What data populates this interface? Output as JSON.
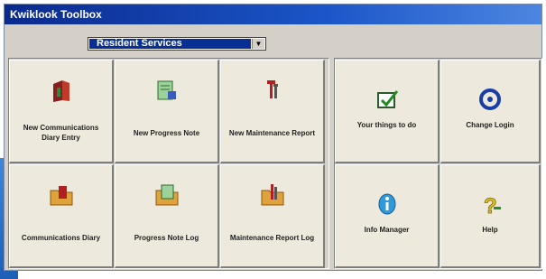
{
  "window": {
    "title": "Kwiklook Toolbox"
  },
  "selector": {
    "value": "Resident Services"
  },
  "buttons": {
    "new_diary": {
      "label": "New Communications Diary Entry",
      "icon": "red-book-icon"
    },
    "new_progress": {
      "label": "New Progress Note",
      "icon": "note-pencil-icon"
    },
    "new_maintenance": {
      "label": "New Maintenance Report",
      "icon": "tools-icon"
    },
    "things_to_do": {
      "label": "Your things to do",
      "icon": "green-checkbox-icon"
    },
    "change_login": {
      "label": "Change Login",
      "icon": "blue-ring-icon"
    },
    "diary": {
      "label": "Communications Diary",
      "icon": "folder-book-icon"
    },
    "progress_log": {
      "label": "Progress Note Log",
      "icon": "folder-note-icon"
    },
    "maintenance_log": {
      "label": "Maintenance Report Log",
      "icon": "folder-tools-icon"
    },
    "info_manager": {
      "label": "Info Manager",
      "icon": "info-icon"
    },
    "help": {
      "label": "Help",
      "icon": "help-question-icon"
    }
  }
}
